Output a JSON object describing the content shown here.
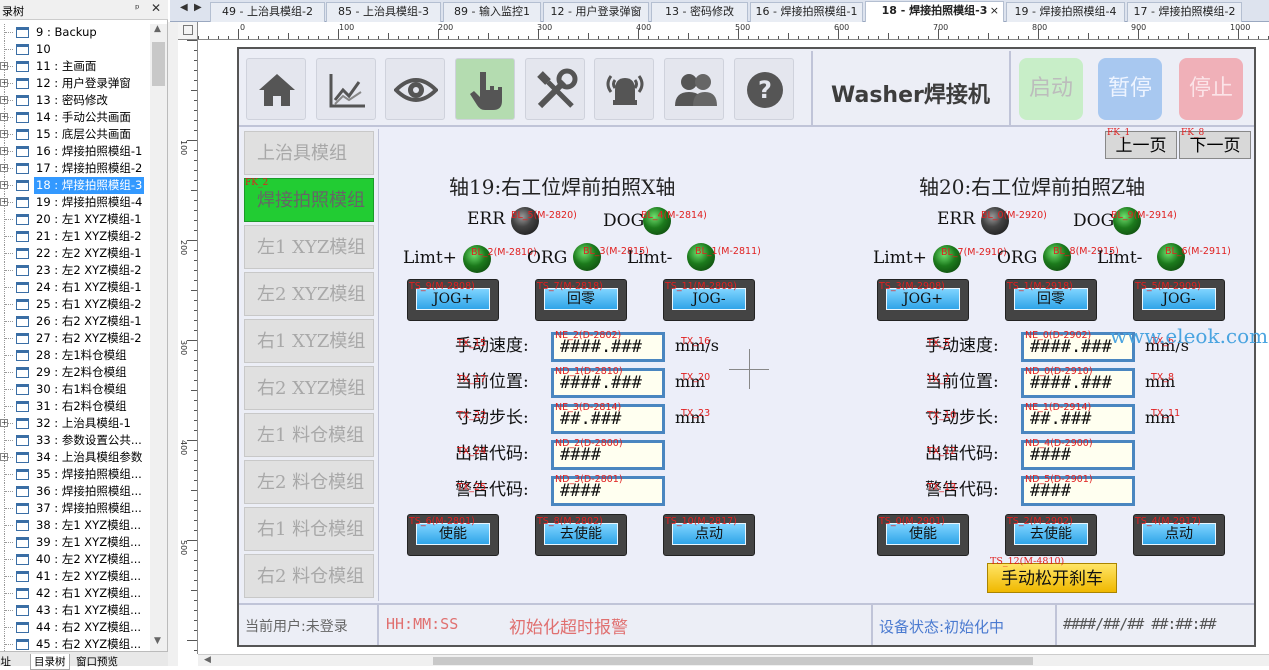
{
  "tree": {
    "title": "录树",
    "pin": "ᵖ",
    "close": "✕",
    "items": [
      {
        "label": "9 : Backup",
        "exp": ""
      },
      {
        "label": "10",
        "exp": ""
      },
      {
        "label": "11 : 主画面",
        "exp": "+"
      },
      {
        "label": "12 : 用户登录弹窗",
        "exp": "+"
      },
      {
        "label": "13 : 密码修改",
        "exp": "+"
      },
      {
        "label": "14 : 手动公共画面",
        "exp": "+"
      },
      {
        "label": "15 : 底层公共画面",
        "exp": "+"
      },
      {
        "label": "16 : 焊接拍照模组-1",
        "exp": "+"
      },
      {
        "label": "17 : 焊接拍照模组-2",
        "exp": "+"
      },
      {
        "label": "18 : 焊接拍照模组-3",
        "exp": "+",
        "selected": true
      },
      {
        "label": "19 : 焊接拍照模组-4",
        "exp": "+"
      },
      {
        "label": "20 : 左1 XYZ模组-1",
        "exp": ""
      },
      {
        "label": "21 : 左1 XYZ模组-2",
        "exp": ""
      },
      {
        "label": "22 : 左2 XYZ模组-1",
        "exp": ""
      },
      {
        "label": "23 : 左2 XYZ模组-2",
        "exp": ""
      },
      {
        "label": "24 : 右1 XYZ模组-1",
        "exp": ""
      },
      {
        "label": "25 : 右1 XYZ模组-2",
        "exp": ""
      },
      {
        "label": "26 : 右2 XYZ模组-1",
        "exp": ""
      },
      {
        "label": "27 : 右2 XYZ模组-2",
        "exp": ""
      },
      {
        "label": "28 : 左1料仓模组",
        "exp": ""
      },
      {
        "label": "29 : 左2料仓模组",
        "exp": ""
      },
      {
        "label": "30 : 右1料仓模组",
        "exp": ""
      },
      {
        "label": "31 : 右2料仓模组",
        "exp": ""
      },
      {
        "label": "32 : 上治具模组-1",
        "exp": "+"
      },
      {
        "label": "33 : 参数设置公共...",
        "exp": ""
      },
      {
        "label": "34 : 上治具模组参数",
        "exp": "+"
      },
      {
        "label": "35 : 焊接拍照模组...",
        "exp": ""
      },
      {
        "label": "36 : 焊接拍照模组...",
        "exp": ""
      },
      {
        "label": "37 : 焊接拍照模组...",
        "exp": ""
      },
      {
        "label": "38 : 左1 XYZ模组...",
        "exp": ""
      },
      {
        "label": "39 : 左1 XYZ模组...",
        "exp": ""
      },
      {
        "label": "40 : 左2 XYZ模组...",
        "exp": ""
      },
      {
        "label": "41 : 左2 XYZ模组...",
        "exp": ""
      },
      {
        "label": "42 : 右1 XYZ模组...",
        "exp": ""
      },
      {
        "label": "43 : 右1 XYZ模组...",
        "exp": ""
      },
      {
        "label": "44 : 右2 XYZ模组...",
        "exp": ""
      },
      {
        "label": "45 : 右2 XYZ模组...",
        "exp": ""
      }
    ],
    "bottom_tabs": [
      "地址",
      "目录树",
      "窗口预览"
    ]
  },
  "tabs": {
    "nav_left": "◀",
    "nav_right": "▶",
    "items": [
      "49 - 上治具模组-2",
      "85 - 上治具模组-3",
      "89 - 输入监控1",
      "12 - 用户登录弹窗",
      "13 - 密码修改",
      "16 - 焊接拍照模组-1",
      "18 - 焊接拍照模组-3",
      "19 - 焊接拍照模组-4",
      "17 - 焊接拍照模组-2"
    ],
    "close": "×"
  },
  "ruler": {
    "h": [
      "0",
      "100",
      "200",
      "300",
      "400",
      "500",
      "600",
      "700",
      "800",
      "900",
      "1000"
    ],
    "v": [
      "100",
      "200",
      "300",
      "400",
      "500"
    ]
  },
  "toolbar": {
    "icons": [
      "home-icon",
      "chart-icon",
      "eye-icon",
      "touch-icon",
      "tools-icon",
      "alarm-icon",
      "users-icon",
      "help-icon"
    ],
    "title": "Washer焊接机",
    "start": "启动",
    "pause": "暂停",
    "stop": "停止",
    "colors": {
      "start": "#c8eec8",
      "pause": "#a8c8f0",
      "stop": "#f0b0b8"
    }
  },
  "menu": {
    "items": [
      {
        "label": "上治具模组"
      },
      {
        "label": "焊接拍照模组",
        "tag": "FK_2",
        "active": true
      },
      {
        "label": "左1 XYZ模组"
      },
      {
        "label": "左2 XYZ模组"
      },
      {
        "label": "右1 XYZ模组"
      },
      {
        "label": "右2 XYZ模组"
      },
      {
        "label": "左1 料仓模组"
      },
      {
        "label": "左2 料仓模组"
      },
      {
        "label": "右1 料仓模组"
      },
      {
        "label": "右2 料仓模组"
      }
    ]
  },
  "paging": {
    "prev": "上一页",
    "prev_tag": "FK_1",
    "next": "下一页",
    "next_tag": "FK_8"
  },
  "axes": [
    {
      "title": "轴19:右工位焊前拍照X轴",
      "err": "ERR",
      "err_tag": "BL_5(M-2820)",
      "dog": "DOG",
      "dog_tag": "BL_4(M-2814)",
      "limp": "Limt+",
      "limp_tag": "BL_2(M-2810)",
      "org": "ORG",
      "org_tag": "BL_3(M-2815)",
      "limm": "Limt-",
      "limm_tag": "BL_1(M-2811)",
      "jogp": "JOG+",
      "jogp_tag": "TS_9(M-2808)",
      "home": "回零",
      "home_tag": "TS_7(M-2818)",
      "jogm": "JOG-",
      "jogm_tag": "TS_11(M-2809)",
      "rows": [
        {
          "label": "手动速度:",
          "tag": "NE_2(D-2802)",
          "value": "####.###",
          "unit": "mm/s",
          "ltag": "TX_15",
          "utag": "TX_16"
        },
        {
          "label": "当前位置:",
          "tag": "ND_1(D-2810)",
          "value": "####.###",
          "unit": "mm",
          "ltag": "TX_17",
          "utag": "TX_20"
        },
        {
          "label": "寸动步长:",
          "tag": "NE_3(D-2814)",
          "value": "##.###",
          "unit": "mm",
          "ltag": "TX_22",
          "utag": "TX_23"
        },
        {
          "label": "出错代码:",
          "tag": "ND_2(D-2800)",
          "value": "####",
          "unit": "",
          "ltag": "TX_24",
          "utag": ""
        },
        {
          "label": "警告代码:",
          "tag": "ND_3(D-2801)",
          "value": "####",
          "unit": "",
          "ltag": "TX_25",
          "utag": ""
        }
      ],
      "enable": "使能",
      "enable_tag": "TS_6(M-2801)",
      "disable": "去使能",
      "disable_tag": "TS_8(M-2802)",
      "inch": "点动",
      "inch_tag": "TS_10(M-2817)"
    },
    {
      "title": "轴20:右工位焊前拍照Z轴",
      "err": "ERR",
      "err_tag": "BL_0(M-2920)",
      "dog": "DOG",
      "dog_tag": "BL_9(M-2914)",
      "limp": "Limt+",
      "limp_tag": "BL_7(M-2910)",
      "org": "ORG",
      "org_tag": "BL_8(M-2915)",
      "limm": "Limt-",
      "limm_tag": "BL_6(M-2911)",
      "jogp": "JOG+",
      "jogp_tag": "TS_3(M-2908)",
      "home": "回零",
      "home_tag": "TS_1(M-2918)",
      "jogm": "JOG-",
      "jogm_tag": "TS_5(M-2909)",
      "rows": [
        {
          "label": "手动速度:",
          "tag": "NE_0(D-2902)",
          "value": "####.###",
          "unit": "mm/s",
          "ltag": "TX_5",
          "utag": "TX_6"
        },
        {
          "label": "当前位置:",
          "tag": "ND_0(D-2910)",
          "value": "####.###",
          "unit": "mm",
          "ltag": "TX_7",
          "utag": "TX_8"
        },
        {
          "label": "寸动步长:",
          "tag": "NE_1(D-2914)",
          "value": "##.###",
          "unit": "mm",
          "ltag": "TX_10",
          "utag": "TX_11"
        },
        {
          "label": "出错代码:",
          "tag": "ND_4(D-2900)",
          "value": "####",
          "unit": "",
          "ltag": "TX_12",
          "utag": ""
        },
        {
          "label": "警告代码:",
          "tag": "ND_5(D-2901)",
          "value": "####",
          "unit": "",
          "ltag": "TX_13",
          "utag": ""
        }
      ],
      "enable": "使能",
      "enable_tag": "TS_0(M-2901)",
      "disable": "去使能",
      "disable_tag": "TS_2(M-2902)",
      "inch": "点动",
      "inch_tag": "TS_4(M-2917)"
    }
  ],
  "brake": {
    "label": "手动松开刹车",
    "tag": "TS_12(M-4810)"
  },
  "status": {
    "user": "当前用户:未登录",
    "time": "HH:MM:SS",
    "alarm": "初始化超时报警",
    "device": "设备状态:初始化中",
    "datetime": "####/##/## ##:##:##"
  },
  "watermark": "www.eleok.com"
}
